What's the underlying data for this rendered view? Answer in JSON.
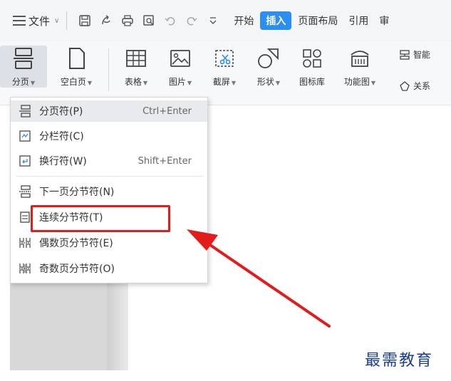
{
  "menubar": {
    "hamburger_icon": "hamburger-menu-icon",
    "file_label": "文件",
    "quick_access_icons": [
      "save-icon",
      "export-pdf-icon",
      "print-icon",
      "print-preview-icon",
      "undo-icon",
      "redo-icon",
      "customize-dropdown-icon"
    ],
    "tabs": [
      {
        "label": "开始"
      },
      {
        "label": "插入"
      },
      {
        "label": "页面布局"
      },
      {
        "label": "引用"
      },
      {
        "label": "审"
      }
    ]
  },
  "ribbon": {
    "buttons": [
      {
        "label": "分页",
        "icon": "page-break-icon"
      },
      {
        "label": "空白页",
        "icon": "blank-page-icon"
      },
      {
        "label": "表格",
        "icon": "table-icon"
      },
      {
        "label": "图片",
        "icon": "picture-icon"
      },
      {
        "label": "截屏",
        "icon": "screenshot-icon"
      },
      {
        "label": "形状",
        "icon": "shapes-icon"
      },
      {
        "label": "图标库",
        "icon": "icon-library-icon"
      },
      {
        "label": "功能图",
        "icon": "function-chart-icon"
      }
    ],
    "small_buttons": [
      {
        "label": "智能",
        "icon": "smart-graphic-icon"
      },
      {
        "label": "关系",
        "icon": "relationship-icon"
      }
    ]
  },
  "dropdown": {
    "items": [
      {
        "label": "分页符(P)",
        "shortcut": "Ctrl+Enter",
        "icon": "page-break-icon"
      },
      {
        "label": "分栏符(C)",
        "shortcut": "",
        "icon": "column-break-icon"
      },
      {
        "label": "换行符(W)",
        "shortcut": "Shift+Enter",
        "icon": "line-break-icon"
      },
      {
        "label": "下一页分节符(N)",
        "shortcut": "",
        "icon": "next-page-section-break-icon"
      },
      {
        "label": "连续分节符(T)",
        "shortcut": "",
        "icon": "continuous-section-break-icon"
      },
      {
        "label": "偶数页分节符(E)",
        "shortcut": "",
        "icon": "even-page-section-break-icon"
      },
      {
        "label": "奇数页分节符(O)",
        "shortcut": "",
        "icon": "odd-page-section-break-icon"
      }
    ]
  },
  "annotation": {
    "highlight_color": "#e31b1b",
    "arrow_color": "#e31b1b"
  },
  "watermark": "最需教育",
  "colors": {
    "accent": "#2b8ef0",
    "annotation": "#e31b1b",
    "watermark": "#1a3d8f"
  }
}
